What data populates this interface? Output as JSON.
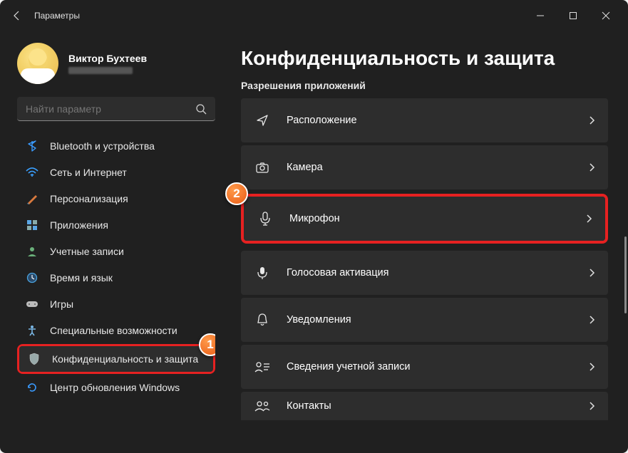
{
  "window": {
    "title": "Параметры"
  },
  "profile": {
    "name": "Виктор Бухтеев"
  },
  "search": {
    "placeholder": "Найти параметр"
  },
  "sidebar": {
    "items": [
      {
        "label": "Bluetooth и устройства"
      },
      {
        "label": "Сеть и Интернет"
      },
      {
        "label": "Персонализация"
      },
      {
        "label": "Приложения"
      },
      {
        "label": "Учетные записи"
      },
      {
        "label": "Время и язык"
      },
      {
        "label": "Игры"
      },
      {
        "label": "Специальные возможности"
      },
      {
        "label": "Конфиденциальность и защита"
      },
      {
        "label": "Центр обновления Windows"
      }
    ]
  },
  "content": {
    "title": "Конфиденциальность и защита",
    "section": "Разрешения приложений",
    "cards": [
      {
        "label": "Расположение"
      },
      {
        "label": "Камера"
      },
      {
        "label": "Микрофон"
      },
      {
        "label": "Голосовая активация"
      },
      {
        "label": "Уведомления"
      },
      {
        "label": "Сведения учетной записи"
      },
      {
        "label": "Контакты"
      }
    ]
  },
  "annotations": {
    "a1": "1",
    "a2": "2"
  }
}
